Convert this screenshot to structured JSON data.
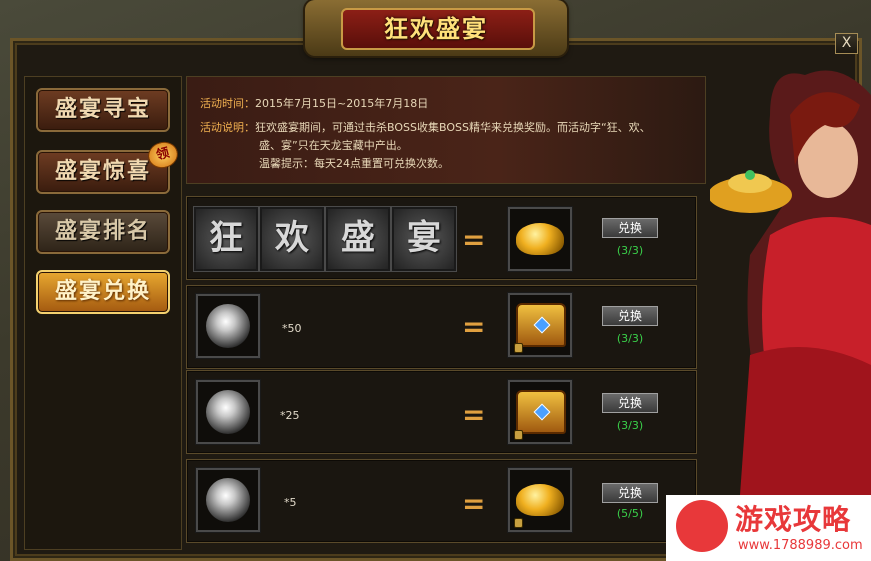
{
  "window": {
    "title": "狂欢盛宴",
    "close_label": "X"
  },
  "menu": {
    "items": [
      {
        "label": "盛宴寻宝",
        "state": "normal"
      },
      {
        "label": "盛宴惊喜",
        "state": "normal",
        "badge": "领"
      },
      {
        "label": "盛宴排名",
        "state": "inactive"
      },
      {
        "label": "盛宴兑换",
        "state": "active"
      }
    ]
  },
  "info": {
    "time_label": "活动时间：",
    "time_value": "2015年7月15日~2015年7月18日",
    "desc_label": "活动说明：",
    "desc_line1": "狂欢盛宴期间，可通过击杀BOSS收集BOSS精华来兑换奖励。而活动字“狂、欢、",
    "desc_line2": "盛、宴”只在天龙宝藏中产出。",
    "tip": "温馨提示：每天24点重置可兑换次数。"
  },
  "exchange": {
    "chars": [
      "狂",
      "欢",
      "盛",
      "宴"
    ],
    "equals": "=",
    "button_label": "兑换",
    "rows": [
      {
        "cost_item": "festival-characters",
        "qty": "",
        "reward": "gold-ingots",
        "count": "(3/3)"
      },
      {
        "cost_item": "boss-essence",
        "qty": "*50",
        "reward": "treasure-chest",
        "count": "(3/3)"
      },
      {
        "cost_item": "boss-essence",
        "qty": "*25",
        "reward": "treasure-chest",
        "count": "(3/3)"
      },
      {
        "cost_item": "boss-essence",
        "qty": "*5",
        "reward": "gold-ingots",
        "count": "(5/5)"
      }
    ]
  },
  "watermark": {
    "title": "游戏攻略",
    "url": "www.1788989.com"
  },
  "colors": {
    "accent_gold": "#ffe07a",
    "count_green": "#3ad04a",
    "label_orange": "#f0b050"
  }
}
